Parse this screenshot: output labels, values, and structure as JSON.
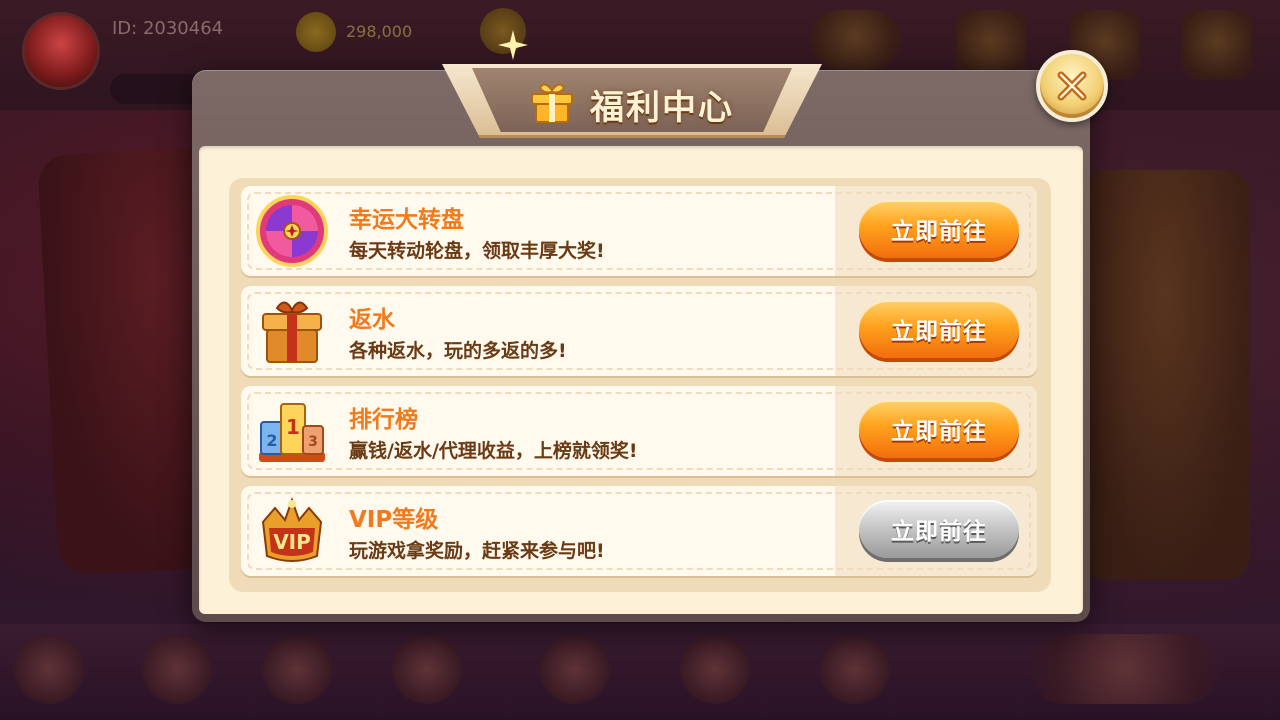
{
  "background": {
    "player_id": "ID: 2030464",
    "coin_value": "298,000"
  },
  "modal": {
    "title": "福利中心",
    "close_label": "×",
    "items": [
      {
        "title": "幸运大转盘",
        "desc": "每天转动轮盘，领取丰厚大奖!",
        "button": "立即前往",
        "button_state": "active",
        "icon": "wheel-icon"
      },
      {
        "title": "返水",
        "desc": "各种返水，玩的多返的多!",
        "button": "立即前往",
        "button_state": "active",
        "icon": "gift-box-icon"
      },
      {
        "title": "排行榜",
        "desc": "赢钱/返水/代理收益，上榜就领奖!",
        "button": "立即前往",
        "button_state": "active",
        "icon": "ranking-podium-icon"
      },
      {
        "title": "VIP等级",
        "desc": "玩游戏拿奖励，赶紧来参与吧!",
        "button": "立即前往",
        "button_state": "disabled",
        "icon": "vip-crown-icon"
      }
    ]
  },
  "colors": {
    "accent_orange": "#f07a1c",
    "desc_brown": "#6a3a14",
    "panel_cream": "#fdf1d8"
  }
}
